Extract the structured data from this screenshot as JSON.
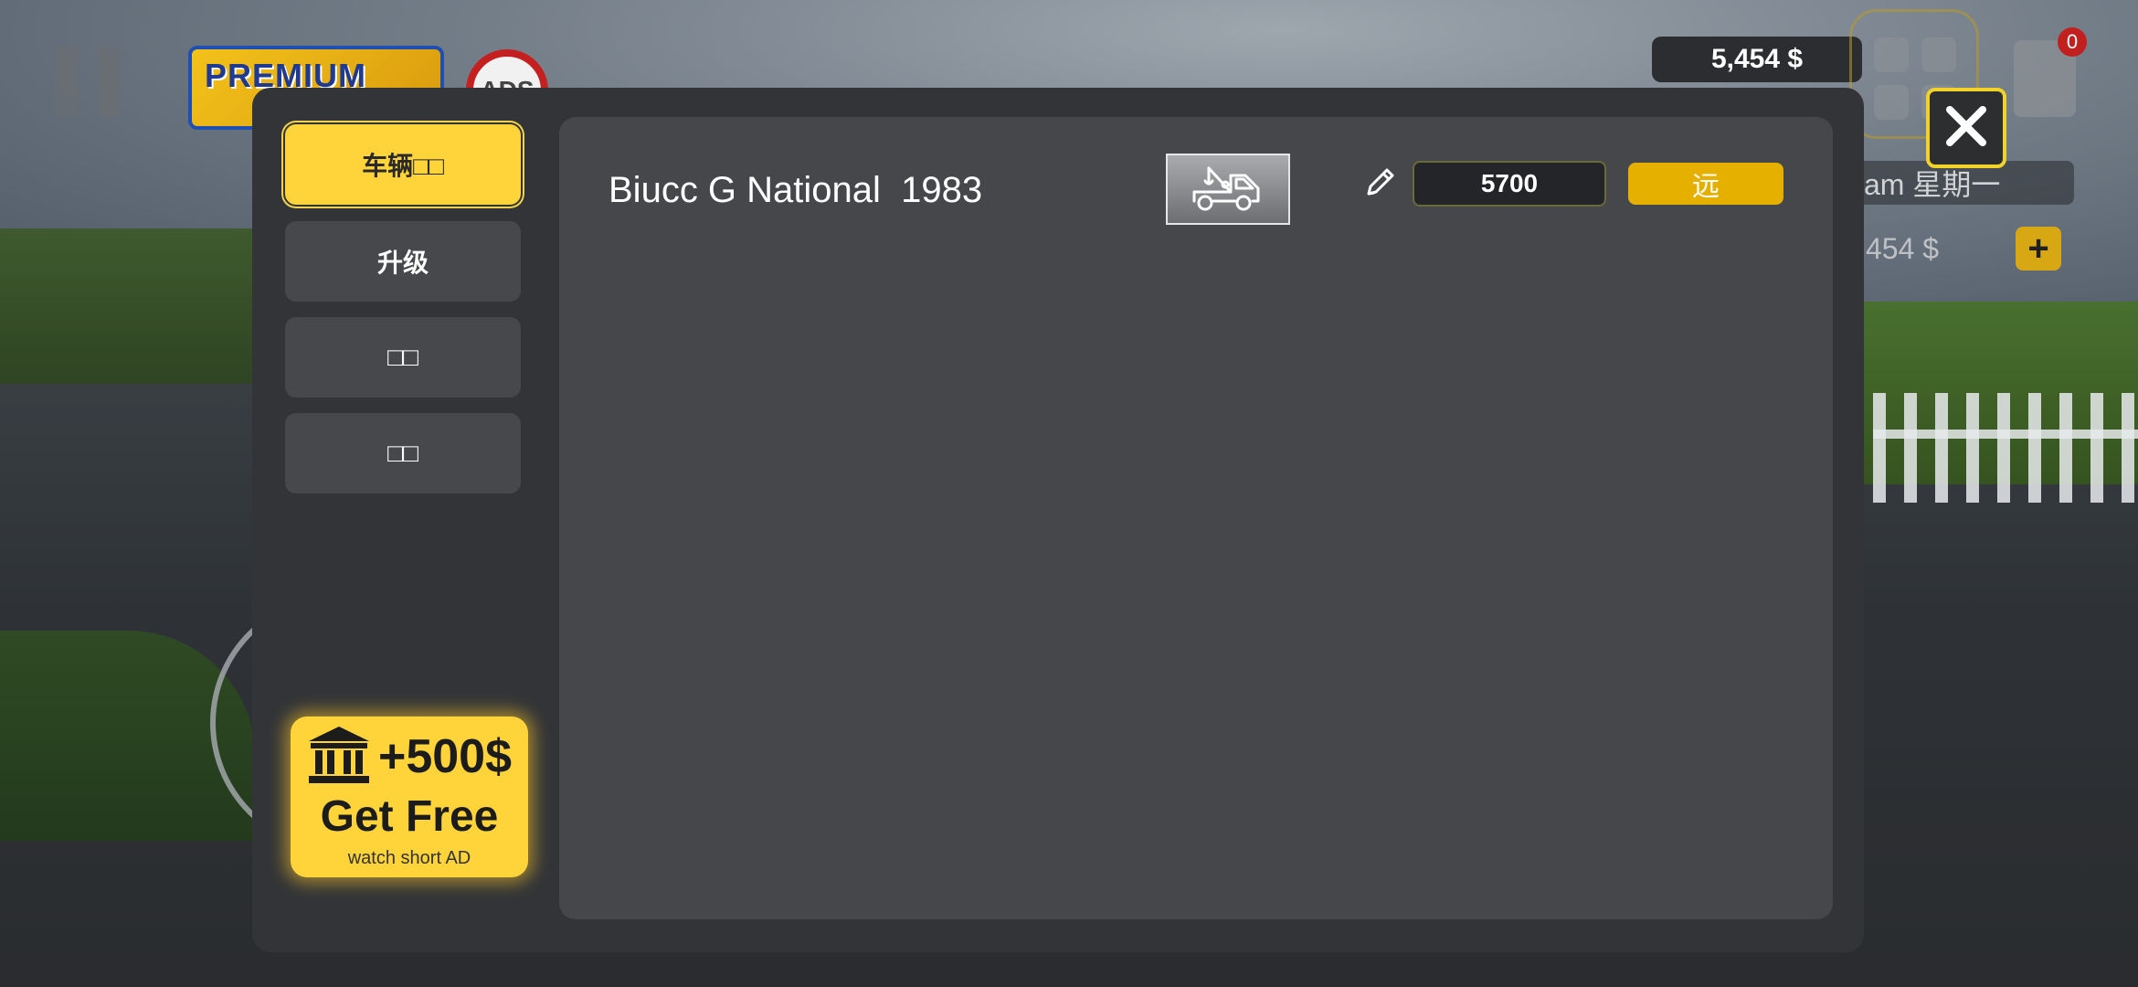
{
  "hud": {
    "premium_label": "PREMIUM",
    "noads_label": "ADS",
    "money": "5,454 $",
    "inventory_count": "0",
    "date_text": "am  星期一",
    "money_secondary": "454 $",
    "plus_label": "+"
  },
  "modal": {
    "tabs": [
      {
        "label": "车辆□□",
        "active": true
      },
      {
        "label": "升级",
        "active": false
      },
      {
        "label": "□□",
        "active": false
      },
      {
        "label": "□□",
        "active": false
      }
    ],
    "ad": {
      "amount": "+500$",
      "title": "Get Free",
      "subtitle": "watch short AD"
    },
    "vehicle": {
      "name": "Biucc G National  1983",
      "tow_icon": "tow-truck-icon",
      "price_value": "5700",
      "sell_label": "远"
    },
    "close_icon": "close-icon"
  },
  "colors": {
    "accent_yellow": "#ffd43a",
    "sell_yellow": "#e5b000",
    "modal_bg": "#323437",
    "panel_bg": "#46474b",
    "badge_red": "#c21f1f"
  }
}
